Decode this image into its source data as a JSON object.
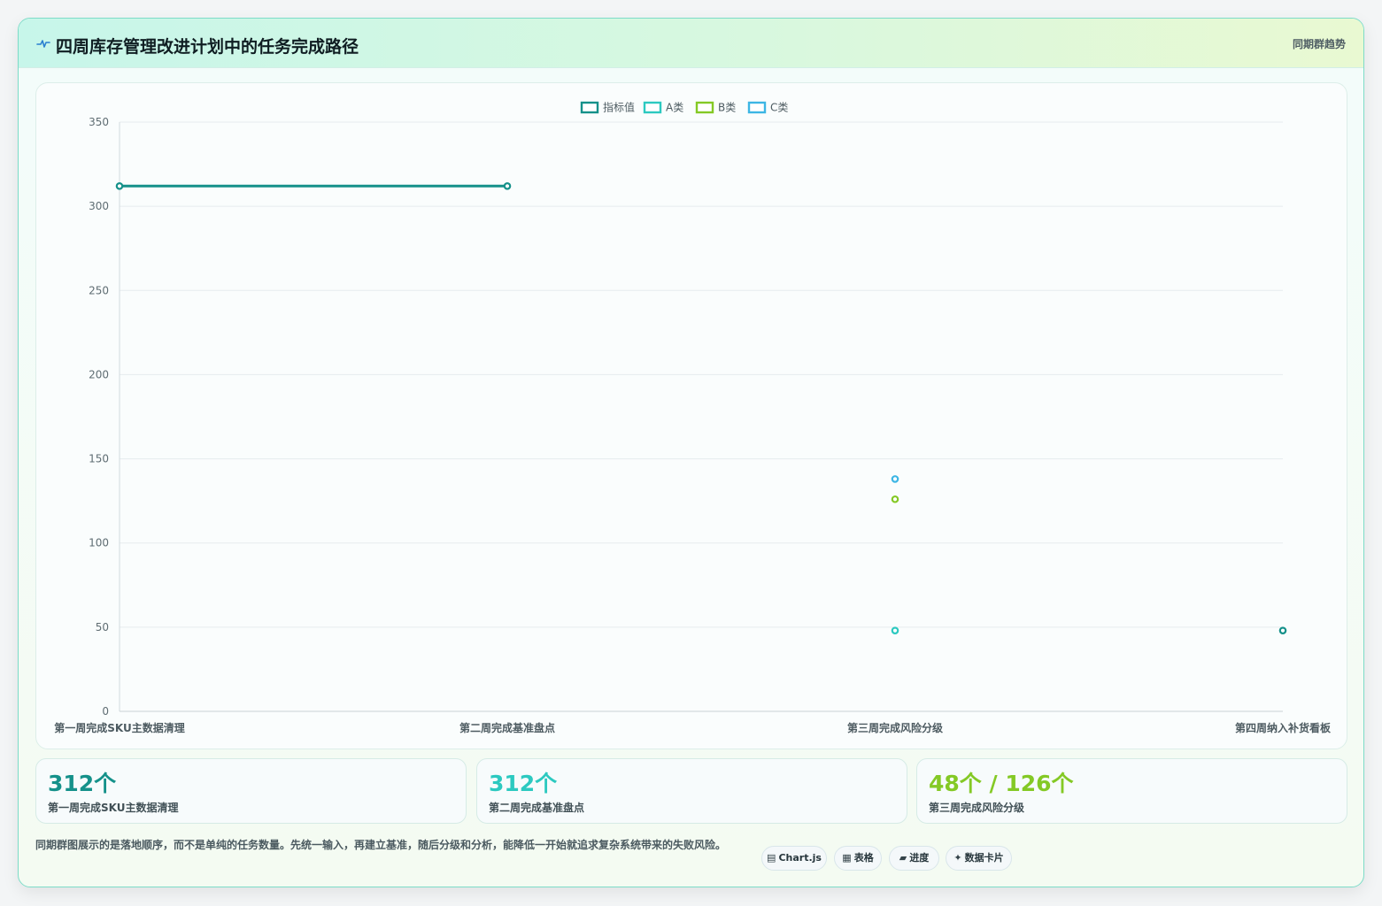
{
  "header": {
    "title": "四周库存管理改进计划中的任务完成路径",
    "tag": "同期群趋势",
    "icon": "pulse-icon"
  },
  "chart_data": {
    "type": "line",
    "categories": [
      "第一周完成SKU主数据清理",
      "第二周完成基准盘点",
      "第三周完成风险分级",
      "第四周纳入补货看板"
    ],
    "ylim": [
      0,
      350
    ],
    "yticks": [
      0,
      50,
      100,
      150,
      200,
      250,
      300,
      350
    ],
    "grid": true,
    "legend_position": "top",
    "series": [
      {
        "name": "指标值",
        "color": "#15918a",
        "values": [
          312,
          312,
          null,
          48
        ]
      },
      {
        "name": "A类",
        "color": "#2cc9c0",
        "values": [
          null,
          null,
          48,
          null
        ]
      },
      {
        "name": "B类",
        "color": "#84c925",
        "values": [
          null,
          null,
          126,
          null
        ]
      },
      {
        "name": "C类",
        "color": "#3db6e4",
        "values": [
          null,
          null,
          138,
          null
        ]
      }
    ]
  },
  "stats": [
    {
      "value": "312个",
      "label": "第一周完成SKU主数据清理",
      "color": "#15918a"
    },
    {
      "value": "312个",
      "label": "第二周完成基准盘点",
      "color": "#2cc9c0"
    },
    {
      "value": "48个 / 126个",
      "label": "第三周完成风险分级",
      "color": "#84c925"
    }
  ],
  "description": "同期群图展示的是落地顺序，而不是单纯的任务数量。先统一输入，再建立基准，随后分级和分析，能降低一开始就追求复杂系统带来的失败风险。",
  "badges": [
    {
      "icon": "▤",
      "label": "Chart.js"
    },
    {
      "icon": "▦",
      "label": "表格"
    },
    {
      "icon": "▰",
      "label": "进度"
    },
    {
      "icon": "✦",
      "label": "数据卡片"
    }
  ]
}
